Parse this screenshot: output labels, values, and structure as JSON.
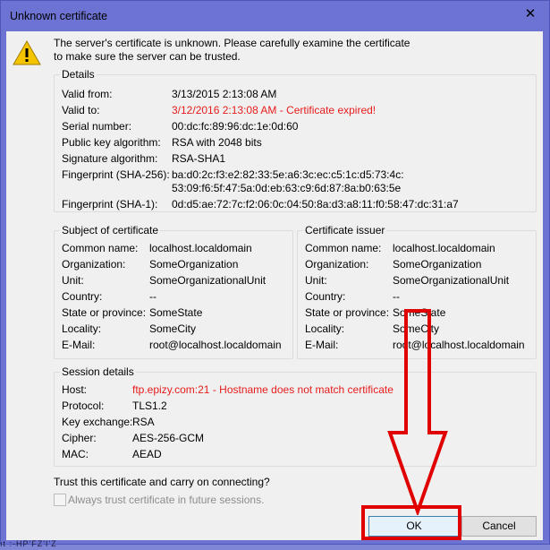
{
  "dialog": {
    "title": "Unknown certificate",
    "close_glyph": "✕",
    "intro_line1": "The server's certificate is unknown. Please carefully examine the certificate",
    "intro_line2": "to make sure the server can be trusted."
  },
  "details": {
    "legend": "Details",
    "valid_from_label": "Valid from:",
    "valid_from": "3/13/2015 2:13:08 AM",
    "valid_to_label": "Valid to:",
    "valid_to": "3/12/2016 2:13:08 AM - Certificate expired!",
    "serial_label": "Serial number:",
    "serial": "00:dc:fc:89:96:dc:1e:0d:60",
    "pubkey_label": "Public key algorithm:",
    "pubkey": "RSA with 2048 bits",
    "sigalg_label": "Signature algorithm:",
    "sigalg": "RSA-SHA1",
    "fp256_label": "Fingerprint (SHA-256):",
    "fp256_line1": "ba:d0:2c:f3:e2:82:33:5e:a6:3c:ec:c5:1c:d5:73:4c:",
    "fp256_line2": "53:09:f6:5f:47:5a:0d:eb:63:c9:6d:87:8a:b0:63:5e",
    "fp1_label": "Fingerprint (SHA-1):",
    "fp1": "0d:d5:ae:72:7c:f2:06:0c:04:50:8a:d3:a8:11:f0:58:47:dc:31:a7"
  },
  "subject": {
    "legend": "Subject of certificate",
    "cn_label": "Common name:",
    "cn": "localhost.localdomain",
    "org_label": "Organization:",
    "org": "SomeOrganization",
    "unit_label": "Unit:",
    "unit": "SomeOrganizationalUnit",
    "country_label": "Country:",
    "country": "--",
    "state_label": "State or province:",
    "state": "SomeState",
    "locality_label": "Locality:",
    "locality": "SomeCity",
    "email_label": "E-Mail:",
    "email": "root@localhost.localdomain"
  },
  "issuer": {
    "legend": "Certificate issuer",
    "cn_label": "Common name:",
    "cn": "localhost.localdomain",
    "org_label": "Organization:",
    "org": "SomeOrganization",
    "unit_label": "Unit:",
    "unit": "SomeOrganizationalUnit",
    "country_label": "Country:",
    "country": "--",
    "state_label": "State or province:",
    "state": "SomeState",
    "locality_label": "Locality:",
    "locality": "SomeCity",
    "email_label": "E-Mail:",
    "email": "root@localhost.localdomain"
  },
  "session": {
    "legend": "Session details",
    "host_label": "Host:",
    "host": "ftp.epizy.com:21 - Hostname does not match certificate",
    "protocol_label": "Protocol:",
    "protocol": "TLS1.2",
    "kex_label": "Key exchange:",
    "kex": "RSA",
    "cipher_label": "Cipher:",
    "cipher": "AES-256-GCM",
    "mac_label": "MAC:",
    "mac": "AEAD"
  },
  "footer": {
    "question": "Trust this certificate and carry on connecting?",
    "always_trust_label": "Always trust certificate in future sessions.",
    "ok_label": "OK",
    "cancel_label": "Cancel"
  },
  "colors": {
    "error": "#e81c1c",
    "annotation": "#e00000",
    "titlebar": "#6c73d2"
  },
  "background_text": "ıt :-HP'FZ'I'Z"
}
